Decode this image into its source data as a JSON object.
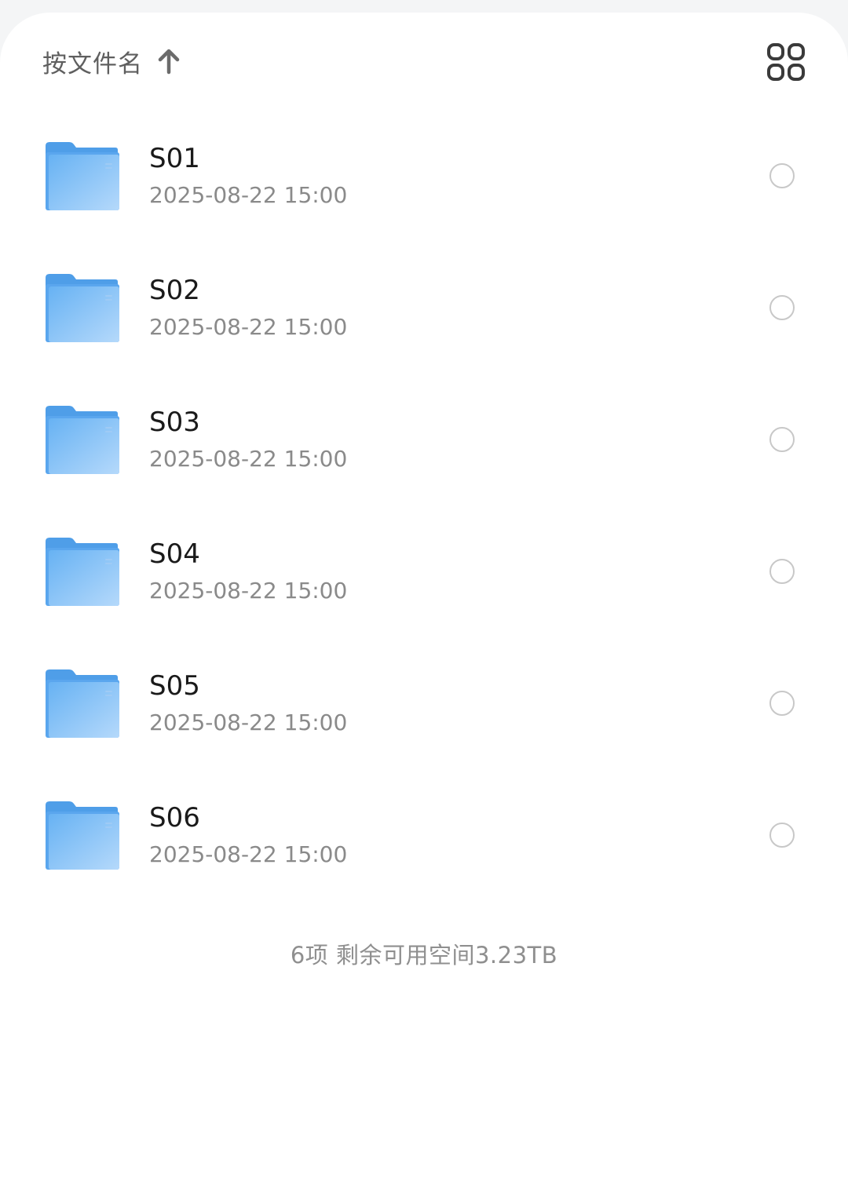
{
  "header": {
    "sort_label": "按文件名",
    "sort_direction_icon": "arrow-up-icon",
    "view_toggle_icon": "grid-view-icon"
  },
  "files": [
    {
      "name": "S01",
      "date": "2025-08-22 15:00",
      "icon": "folder-icon"
    },
    {
      "name": "S02",
      "date": "2025-08-22 15:00",
      "icon": "folder-icon"
    },
    {
      "name": "S03",
      "date": "2025-08-22 15:00",
      "icon": "folder-icon"
    },
    {
      "name": "S04",
      "date": "2025-08-22 15:00",
      "icon": "folder-icon"
    },
    {
      "name": "S05",
      "date": "2025-08-22 15:00",
      "icon": "folder-icon"
    },
    {
      "name": "S06",
      "date": "2025-08-22 15:00",
      "icon": "folder-icon"
    }
  ],
  "footer": {
    "summary": "6项 剩余可用空间3.23TB"
  },
  "colors": {
    "folder_primary": "#5aaaf0",
    "folder_light": "#a9d2fa",
    "text_primary": "#1a1a1a",
    "text_secondary": "#8a8a8a"
  }
}
